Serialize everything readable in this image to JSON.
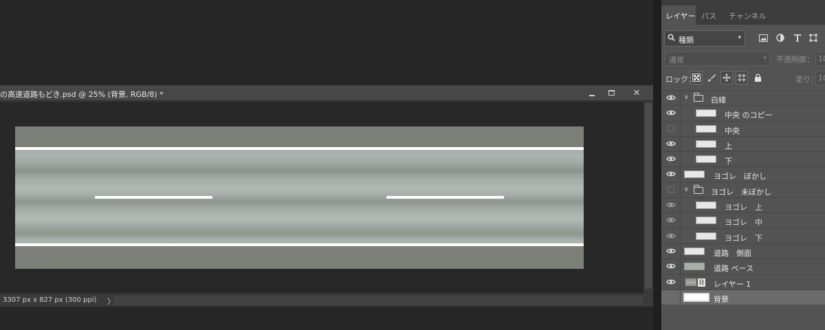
{
  "document": {
    "title": "の高速道路もどき.psd @ 25% (背景, RGB/8) *",
    "status": "3307 px x 827 px (300 ppi)",
    "status_arrow": "〉",
    "window_buttons": {
      "minimize": "minimize-icon",
      "maximize": "maximize-icon",
      "close": "✕"
    },
    "canvas": {
      "road_color": "#a6aeaa",
      "shoulder_color": "#7d8079",
      "line_color": "#ffffff"
    }
  },
  "panel": {
    "tabs": [
      {
        "label": "レイヤー",
        "active": true
      },
      {
        "label": "パス",
        "active": false
      },
      {
        "label": "チャンネル",
        "active": false
      }
    ],
    "filter": {
      "label": "種類",
      "icon": "search-icon"
    },
    "filter_buttons": [
      "image-filter-icon",
      "adjustment-filter-icon",
      "type-filter-icon",
      "shape-filter-icon"
    ],
    "blend_mode": "通常",
    "opacity_label": "不透明度：",
    "opacity_value": "10",
    "lock_label": "ロック：",
    "lock_buttons": [
      "lock-transparency-icon",
      "lock-paint-icon",
      "lock-position-icon",
      "lock-artboard-icon",
      "lock-all-icon"
    ],
    "fill_label": "塗り：",
    "fill_value": "10",
    "layers": [
      {
        "name": "白線",
        "kind": "group",
        "visible": true,
        "expanded": true,
        "indent": 0
      },
      {
        "name": "中央 のコピー",
        "kind": "layer",
        "visible": true,
        "indent": 1
      },
      {
        "name": "中央",
        "kind": "layer",
        "visible": false,
        "indent": 1
      },
      {
        "name": "上",
        "kind": "layer",
        "visible": true,
        "indent": 1
      },
      {
        "name": "下",
        "kind": "layer",
        "visible": true,
        "indent": 1
      },
      {
        "name": "ヨゴレ　ぼかし",
        "kind": "layer",
        "visible": true,
        "indent": 0
      },
      {
        "name": "ヨゴレ　未ぼかし",
        "kind": "group",
        "visible": false,
        "expanded": true,
        "indent": 0
      },
      {
        "name": "ヨゴレ　上",
        "kind": "layer",
        "visible": true,
        "dim": true,
        "indent": 1
      },
      {
        "name": "ヨゴレ　中",
        "kind": "layer",
        "visible": true,
        "dim": true,
        "indent": 1
      },
      {
        "name": "ヨゴレ　下",
        "kind": "layer",
        "visible": true,
        "dim": true,
        "indent": 1
      },
      {
        "name": "道路　側面",
        "kind": "layer",
        "visible": true,
        "indent": 0
      },
      {
        "name": "道路 ベース",
        "kind": "solid",
        "visible": true,
        "indent": 0
      },
      {
        "name": "レイヤー 1",
        "kind": "photo",
        "visible": true,
        "indent": 0
      },
      {
        "name": "背景",
        "kind": "background",
        "visible": false,
        "selected": true,
        "indent": 0
      }
    ]
  }
}
